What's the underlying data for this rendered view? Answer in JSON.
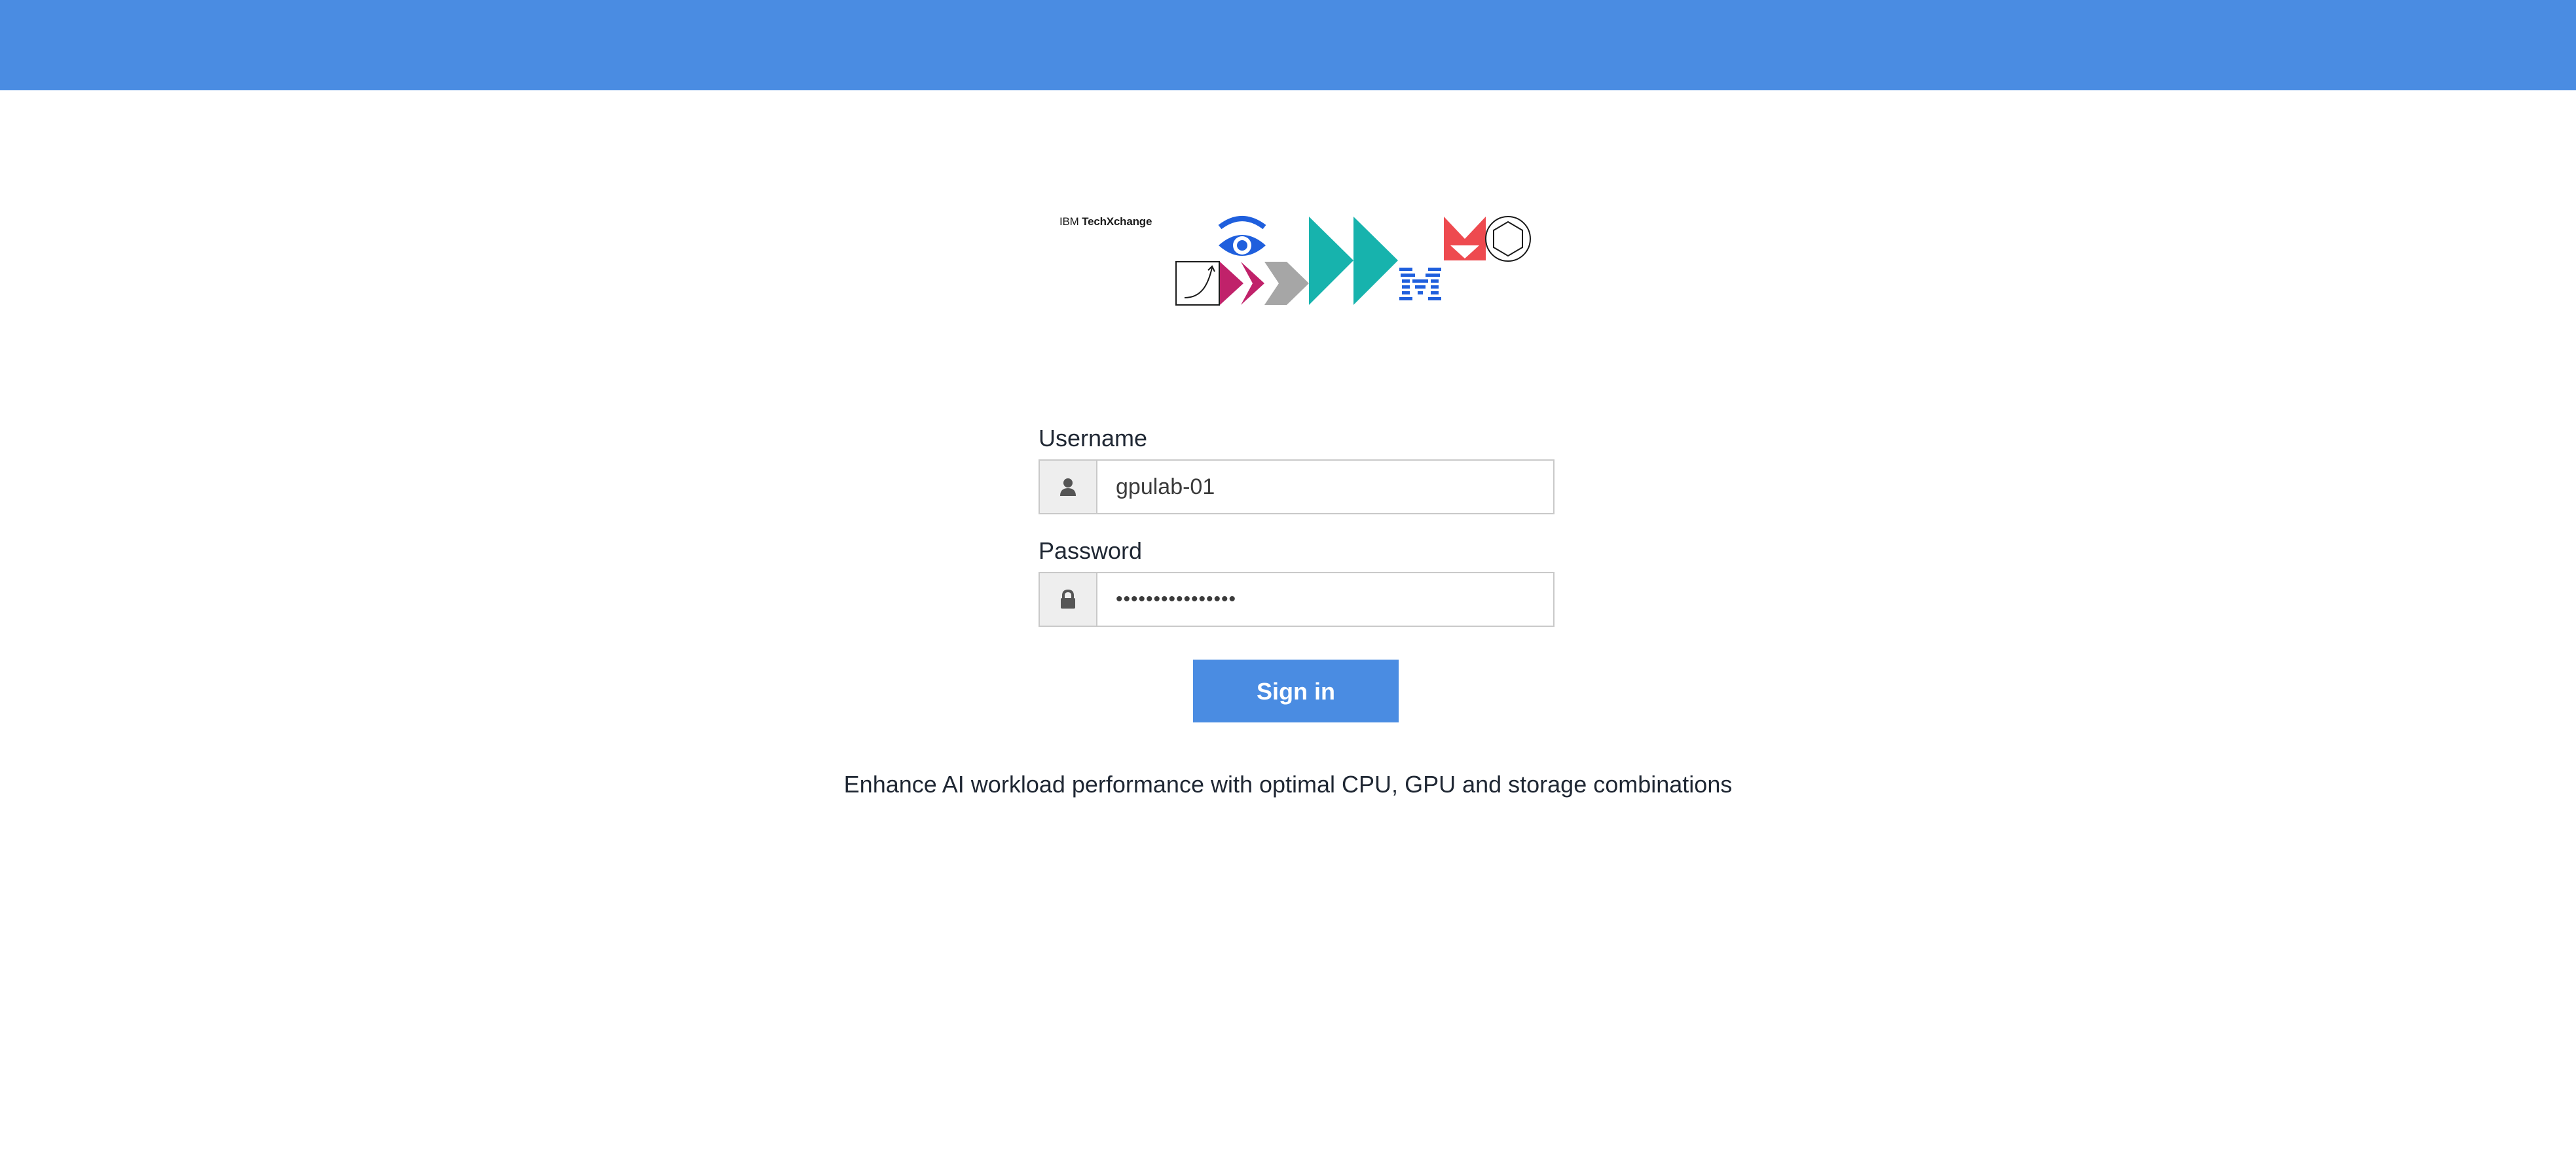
{
  "header": {
    "color": "#4a8ce2"
  },
  "logo": {
    "brand": "IBM",
    "product": "TechXchange",
    "icons": [
      "chart-box-icon",
      "eye-icon",
      "chevron-pink-icon",
      "chevron-gray-icon",
      "fast-forward-teal-icon",
      "ibm-m-icon",
      "red-heart-icon",
      "hexagon-icon"
    ]
  },
  "form": {
    "username": {
      "label": "Username",
      "value": "gpulab-01",
      "icon": "user-icon"
    },
    "password": {
      "label": "Password",
      "value": "••••••••••••••••",
      "icon": "lock-icon"
    },
    "signin_label": "Sign in"
  },
  "tagline": "Enhance AI workload performance with optimal CPU, GPU and storage combinations",
  "colors": {
    "accent": "#4a8ce2",
    "teal": "#17b3ad",
    "magenta": "#c0226a",
    "gray": "#a6a6a6",
    "red": "#ee4a4f",
    "blue_eye": "#1f5fdd"
  }
}
